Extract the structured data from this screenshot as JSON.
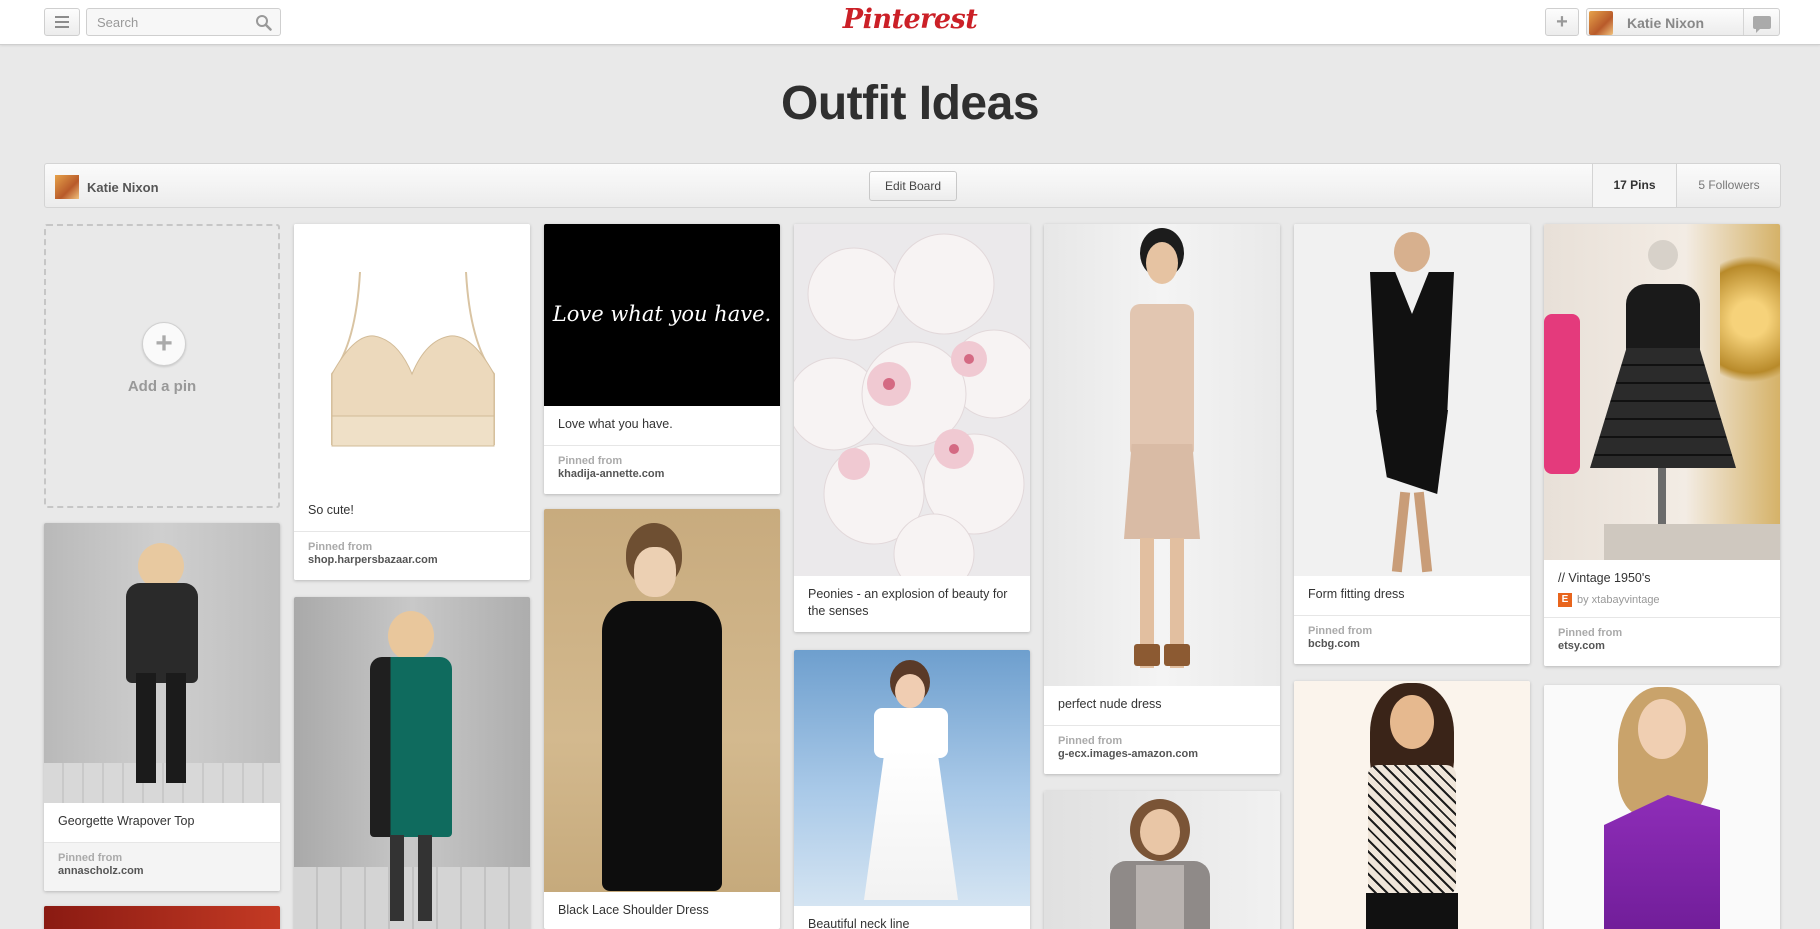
{
  "header": {
    "search_placeholder": "Search",
    "logo": "Pinterest",
    "add_label": "+",
    "user_name": "Katie Nixon"
  },
  "board": {
    "title": "Outfit Ideas",
    "owner": "Katie Nixon",
    "edit_label": "Edit Board",
    "pins_count": "17 Pins",
    "followers_count": "5 Followers"
  },
  "add_pin": {
    "label": "Add a pin",
    "icon": "plus-icon"
  },
  "pins": [
    {
      "desc": "So cute!",
      "source_label": "Pinned from",
      "source": "shop.harpersbazaar.com"
    },
    {
      "desc": "Love what you have.",
      "image_text": "Love what you have.",
      "source_label": "Pinned from",
      "source": "khadija-annette.com"
    },
    {
      "desc": "Peonies - an explosion of beauty for the senses"
    },
    {
      "desc": "perfect nude dress",
      "source_label": "Pinned from",
      "source": "g-ecx.images-amazon.com"
    },
    {
      "desc": "Form fitting dress",
      "source_label": "Pinned from",
      "source": "bcbg.com"
    },
    {
      "desc": "// Vintage 1950's",
      "byline": "by xtabayvintage",
      "source_label": "Pinned from",
      "source": "etsy.com"
    },
    {
      "desc": "Georgette Wrapover Top",
      "source_label": "Pinned from",
      "source": "annascholz.com"
    },
    {
      "desc": "Black Lace Shoulder Dress"
    },
    {
      "desc": "Beautiful neck line"
    }
  ],
  "colors": {
    "brand": "#cb2027",
    "background": "#e9e9e9"
  }
}
